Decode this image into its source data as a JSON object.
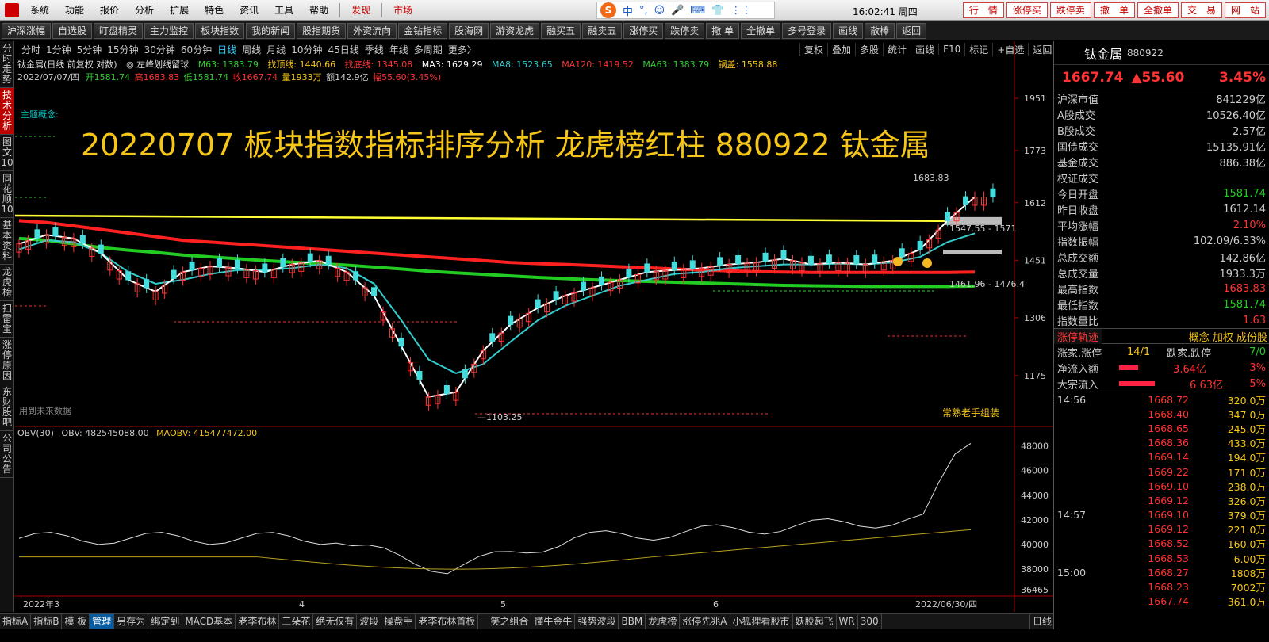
{
  "menubar": {
    "items": [
      "系统",
      "功能",
      "报价",
      "分析",
      "扩展",
      "特色",
      "资讯",
      "工具",
      "帮助"
    ],
    "discover": "发现",
    "market": "市场",
    "clock": "16:02:41 周四",
    "right_buttons": [
      "行　情",
      "涨停买",
      "跌停卖",
      "撤　单",
      "全撤单",
      "交　易",
      "网　站"
    ],
    "ime": [
      "中",
      "°,",
      "☺",
      "🎤",
      "⌨",
      "👕",
      "⋮⋮"
    ]
  },
  "toolbar": {
    "items": [
      "沪深涨幅",
      "自选股",
      "盯盘精灵",
      "主力监控",
      "板块指数",
      "我的新闻",
      "股指期货",
      "外资流向",
      "金钻指标",
      "股海网",
      "游资龙虎",
      "融买五",
      "融卖五",
      "涨停买",
      "跌停卖",
      "撤 单",
      "全撤单",
      "多号登录",
      "画线",
      "散棒",
      "返回"
    ]
  },
  "left_tabs": [
    {
      "label": "分时走势",
      "active": false
    },
    {
      "label": "技术分析",
      "active": true
    },
    {
      "label": "图文10",
      "active": false
    },
    {
      "label": "同花顺10",
      "active": false
    },
    {
      "label": "基本资料",
      "active": false
    },
    {
      "label": "龙虎榜",
      "active": false
    },
    {
      "label": "扫雷宝",
      "active": false
    },
    {
      "label": "涨停原因",
      "active": false
    },
    {
      "label": "东财股吧",
      "active": false
    },
    {
      "label": "公司公告",
      "active": false
    }
  ],
  "period_bar": {
    "items": [
      "分时",
      "1分钟",
      "5分钟",
      "15分钟",
      "30分钟",
      "60分钟",
      "日线",
      "周线",
      "月线",
      "10分钟",
      "45日线",
      "季线",
      "年线",
      "多周期",
      "更多〉"
    ],
    "active": "日线"
  },
  "right_tools": [
    "复权",
    "叠加",
    "多股",
    "统计",
    "画线",
    "F10",
    "标记",
    "+自选",
    "返回"
  ],
  "info_row1": {
    "name": "钛金属(日线 前复权 对数)",
    "indicator": "◎ 左峰划线留球",
    "m63": "M63: 1383.79",
    "zhaoding": "找顶线: 1440.66",
    "zhaodi": "找底线: 1345.08",
    "ma3": "MA3: 1629.29",
    "ma8": "MA8: 1523.65",
    "ma120": "MA120: 1419.52",
    "ma63": "MA63: 1383.79",
    "guogai": "锅盖: 1558.88"
  },
  "info_row2": {
    "date": "2022/07/07/四",
    "open": "开1581.74",
    "high": "高1683.83",
    "low": "低1581.74",
    "close": "收1667.74",
    "vol": "量1933万",
    "amount": "额142.9亿",
    "change": "幅55.60(3.45%)"
  },
  "topic": "主题概念:",
  "overlay_title": "20220707  板块指数指标排序分析 龙虎榜红柱 880922 钛金属",
  "future_data": "用到未来数据",
  "brand": "常熟老手组装",
  "price_axis": {
    "labels": [
      "1951",
      "1773",
      "1612",
      "1451",
      "1306",
      "1175"
    ],
    "ylim": [
      1080,
      2000
    ]
  },
  "annotations": {
    "high": "1683.83",
    "low": "1103.25",
    "level1": "1547.55 - 1571",
    "level2": "1461.96 - 1476.4"
  },
  "x_axis": {
    "labels": [
      "2022年3",
      "4",
      "5",
      "6",
      "2022/06/30/四"
    ]
  },
  "obv": {
    "title": "OBV(30)",
    "obv": "OBV: 482545088.00",
    "maobv": "MAOBV: 415477472.00",
    "axis": [
      "48000",
      "46000",
      "44000",
      "42000",
      "40000",
      "38000",
      "36465"
    ]
  },
  "bottom_tabs": [
    "指标A",
    "指标B",
    "模 板",
    "管理",
    "另存为",
    "绑定到",
    "MACD基本",
    "老李布林",
    "三朵花",
    "绝无仅有",
    "波段",
    "操盘手",
    "老李布林首板",
    "一笑之组合",
    "懂牛金牛",
    "强势波段",
    "BBM",
    "龙虎榜",
    "涨停先兆A",
    "小狐狸看股市",
    "妖股起飞",
    "WR",
    "300"
  ],
  "bottom_active": "管理",
  "bottom_right": "日线",
  "panel": {
    "name": "钛金属",
    "code": "880922",
    "price": "1667.74",
    "change": "▲55.60",
    "pct": "3.45%",
    "stats": [
      {
        "k": "沪深市值",
        "v": "841229亿",
        "c": ""
      },
      {
        "k": "A股成交",
        "v": "10526.40亿",
        "c": ""
      },
      {
        "k": "B股成交",
        "v": "2.57亿",
        "c": ""
      },
      {
        "k": "国债成交",
        "v": "15135.91亿",
        "c": ""
      },
      {
        "k": "基金成交",
        "v": "886.38亿",
        "c": ""
      },
      {
        "k": "权证成交",
        "v": "",
        "c": ""
      },
      {
        "k": "今日开盘",
        "v": "1581.74",
        "c": "green"
      },
      {
        "k": "昨日收盘",
        "v": "1612.14",
        "c": ""
      },
      {
        "k": "平均涨幅",
        "v": "2.10%",
        "c": "red"
      },
      {
        "k": "指数振幅",
        "v": "102.09/6.33%",
        "c": ""
      },
      {
        "k": "总成交额",
        "v": "142.86亿",
        "c": ""
      },
      {
        "k": "总成交量",
        "v": "1933.3万",
        "c": ""
      },
      {
        "k": "最高指数",
        "v": "1683.83",
        "c": "red"
      },
      {
        "k": "最低指数",
        "v": "1581.74",
        "c": "green"
      },
      {
        "k": "指数量比",
        "v": "1.63",
        "c": "red"
      }
    ],
    "limit_track": "涨停轨迹",
    "limit_links": "概念 加权 成份股",
    "updown_label": "涨家.涨停",
    "updown_val": "14/1",
    "down_label": "跌家.跌停",
    "down_val": "7/0",
    "flows": [
      {
        "k": "净流入额",
        "v": "3.64亿",
        "p": "3%",
        "bar": 40
      },
      {
        "k": "大宗流入",
        "v": "6.63亿",
        "p": "5%",
        "bar": 75
      }
    ],
    "ticks": [
      {
        "t": "14:56",
        "p": "1668.72",
        "v": "320.0万"
      },
      {
        "t": "",
        "p": "1668.40",
        "v": "347.0万"
      },
      {
        "t": "",
        "p": "1668.65",
        "v": "245.0万"
      },
      {
        "t": "",
        "p": "1668.36",
        "v": "433.0万"
      },
      {
        "t": "",
        "p": "1669.14",
        "v": "194.0万"
      },
      {
        "t": "",
        "p": "1669.22",
        "v": "171.0万"
      },
      {
        "t": "",
        "p": "1669.10",
        "v": "238.0万"
      },
      {
        "t": "",
        "p": "1669.12",
        "v": "326.0万"
      },
      {
        "t": "14:57",
        "p": "1669.10",
        "v": "379.0万"
      },
      {
        "t": "",
        "p": "1669.12",
        "v": "221.0万"
      },
      {
        "t": "",
        "p": "1668.52",
        "v": "160.0万"
      },
      {
        "t": "",
        "p": "1668.53",
        "v": "6.00万"
      },
      {
        "t": "15:00",
        "p": "1668.27",
        "v": "1808万"
      },
      {
        "t": "",
        "p": "1668.23",
        "v": "7002万"
      },
      {
        "t": "",
        "p": "1667.74",
        "v": "361.0万"
      }
    ]
  },
  "chart_data": {
    "type": "line",
    "series": [
      {
        "name": "MA3",
        "color": "#ffffff",
        "values": [
          1495,
          1520,
          1510,
          1470,
          1400,
          1370,
          1420,
          1435,
          1430,
          1420,
          1440,
          1450,
          1420,
          1360,
          1240,
          1130,
          1140,
          1230,
          1290,
          1330,
          1360,
          1380,
          1400,
          1420,
          1425,
          1430,
          1440,
          1445,
          1455,
          1440,
          1445,
          1440,
          1450,
          1480,
          1560,
          1629
        ]
      },
      {
        "name": "MA8",
        "color": "#33cccc",
        "values": [
          1480,
          1505,
          1500,
          1470,
          1420,
          1390,
          1400,
          1415,
          1425,
          1425,
          1430,
          1440,
          1430,
          1390,
          1300,
          1210,
          1180,
          1200,
          1250,
          1300,
          1335,
          1360,
          1385,
          1400,
          1415,
          1420,
          1430,
          1435,
          1440,
          1440,
          1442,
          1440,
          1445,
          1460,
          1500,
          1524
        ]
      },
      {
        "name": "MA120",
        "color": "#ff2020",
        "values": [
          1560,
          1555,
          1545,
          1535,
          1525,
          1515,
          1505,
          1500,
          1495,
          1490,
          1485,
          1480,
          1475,
          1470,
          1465,
          1460,
          1455,
          1450,
          1445,
          1442,
          1440,
          1437,
          1434,
          1431,
          1428,
          1425,
          1423,
          1421,
          1420,
          1419,
          1419,
          1419,
          1419,
          1419,
          1419,
          1420
        ]
      },
      {
        "name": "MA63",
        "color": "#22cc22",
        "values": [
          1510,
          1505,
          1495,
          1485,
          1478,
          1472,
          1465,
          1460,
          1455,
          1450,
          1446,
          1442,
          1438,
          1433,
          1428,
          1422,
          1418,
          1414,
          1410,
          1406,
          1403,
          1400,
          1398,
          1396,
          1394,
          1392,
          1390,
          1388,
          1386,
          1385,
          1384,
          1383,
          1383,
          1383,
          1383,
          1384
        ]
      }
    ],
    "ylim": [
      1080,
      2000
    ],
    "guogai": 1558.88
  }
}
